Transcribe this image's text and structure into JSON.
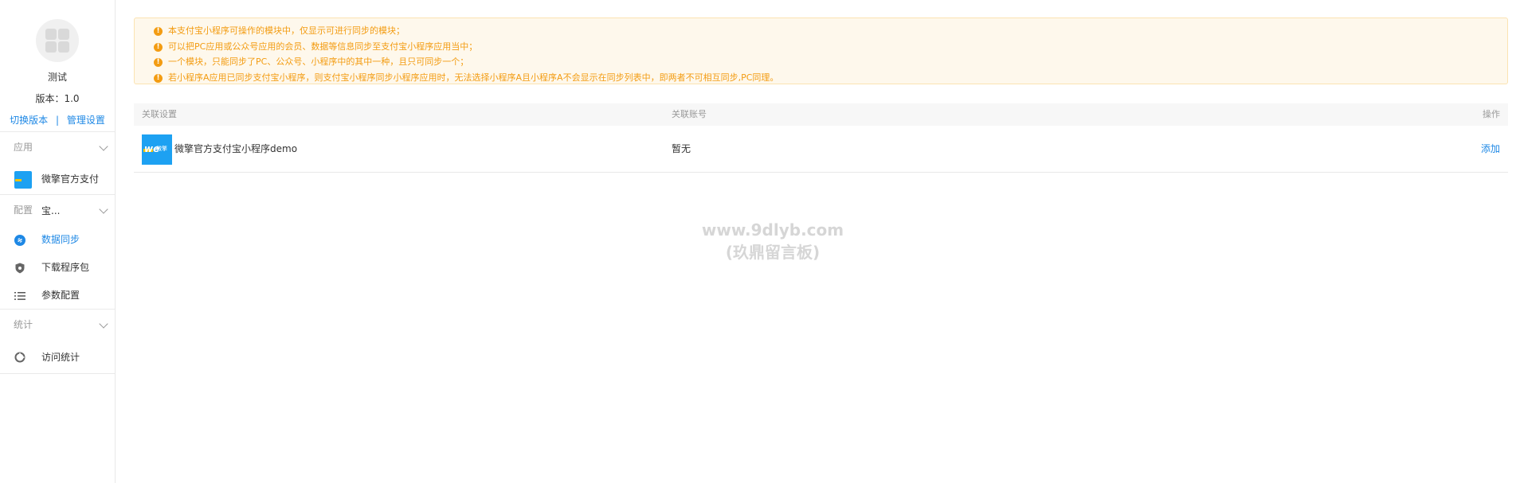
{
  "sidebar": {
    "app_name": "测试",
    "version": "版本：1.0",
    "switch_version": "切换版本",
    "separator": "|",
    "manage_settings": "管理设置",
    "sections": {
      "apps": {
        "title": "应用",
        "items": [
          "微擎官方支付宝..."
        ]
      },
      "config": {
        "title": "配置",
        "items": [
          "数据同步",
          "下载程序包",
          "参数配置"
        ]
      },
      "stats": {
        "title": "统计",
        "items": [
          "访问统计"
        ]
      }
    }
  },
  "notice": {
    "lines": [
      "本支付宝小程序可操作的模块中，仅显示可进行同步的模块；",
      "可以把PC应用或公众号应用的会员、数据等信息同步至支付宝小程序应用当中；",
      "一个模块，只能同步了PC、公众号、小程序中的其中一种，且只可同步一个；",
      "若小程序A应用已同步支付宝小程序，则支付宝小程序同步小程序应用时，无法选择小程序A且小程序A不会显示在同步列表中，即两者不可相互同步,PC同理。"
    ],
    "color": "#f39c12"
  },
  "table": {
    "headers": [
      "关联设置",
      "关联账号",
      "操作"
    ],
    "rows": [
      {
        "name": "微擎官方支付宝小程序demo",
        "account": "暂无",
        "action": "添加"
      }
    ]
  },
  "logo_text": "微擎",
  "watermark": {
    "line1": "www.9dlyb.com",
    "line2": "(玖鼎留言板)"
  },
  "colors": {
    "accent": "#1e88e5",
    "warning": "#f39c12"
  }
}
